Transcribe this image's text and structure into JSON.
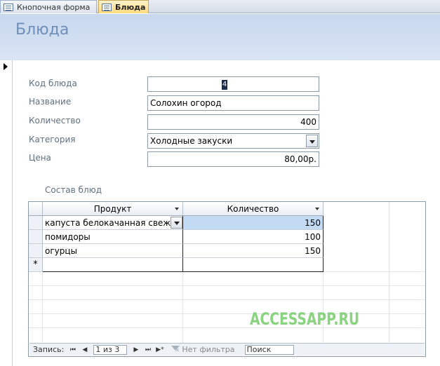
{
  "tabs": [
    {
      "label": "Кнопочная форма",
      "active": false
    },
    {
      "label": "Блюда",
      "active": true
    }
  ],
  "form": {
    "title": "Блюда",
    "fields": {
      "code": {
        "label": "Код блюда",
        "value": "4"
      },
      "name": {
        "label": "Название",
        "value": "Солохин огород"
      },
      "quantity": {
        "label": "Количество",
        "value": "400"
      },
      "category": {
        "label": "Категория",
        "value": "Холодные закуски"
      },
      "price": {
        "label": "Цена",
        "value": "80,00р."
      }
    }
  },
  "subform": {
    "label": "Состав блюд",
    "columns": [
      "Продукт",
      "Количество"
    ],
    "rows": [
      {
        "product": "капуста белокачанная свежая",
        "qty": "150"
      },
      {
        "product": "помидоры",
        "qty": "100"
      },
      {
        "product": "огурцы",
        "qty": "150"
      }
    ],
    "new_row_marker": "*"
  },
  "navigation": {
    "label": "Запись:",
    "current": "1 из 3",
    "filter": "Нет фильтра",
    "search": "Поиск"
  },
  "watermark": "ACCESSAPP.RU"
}
